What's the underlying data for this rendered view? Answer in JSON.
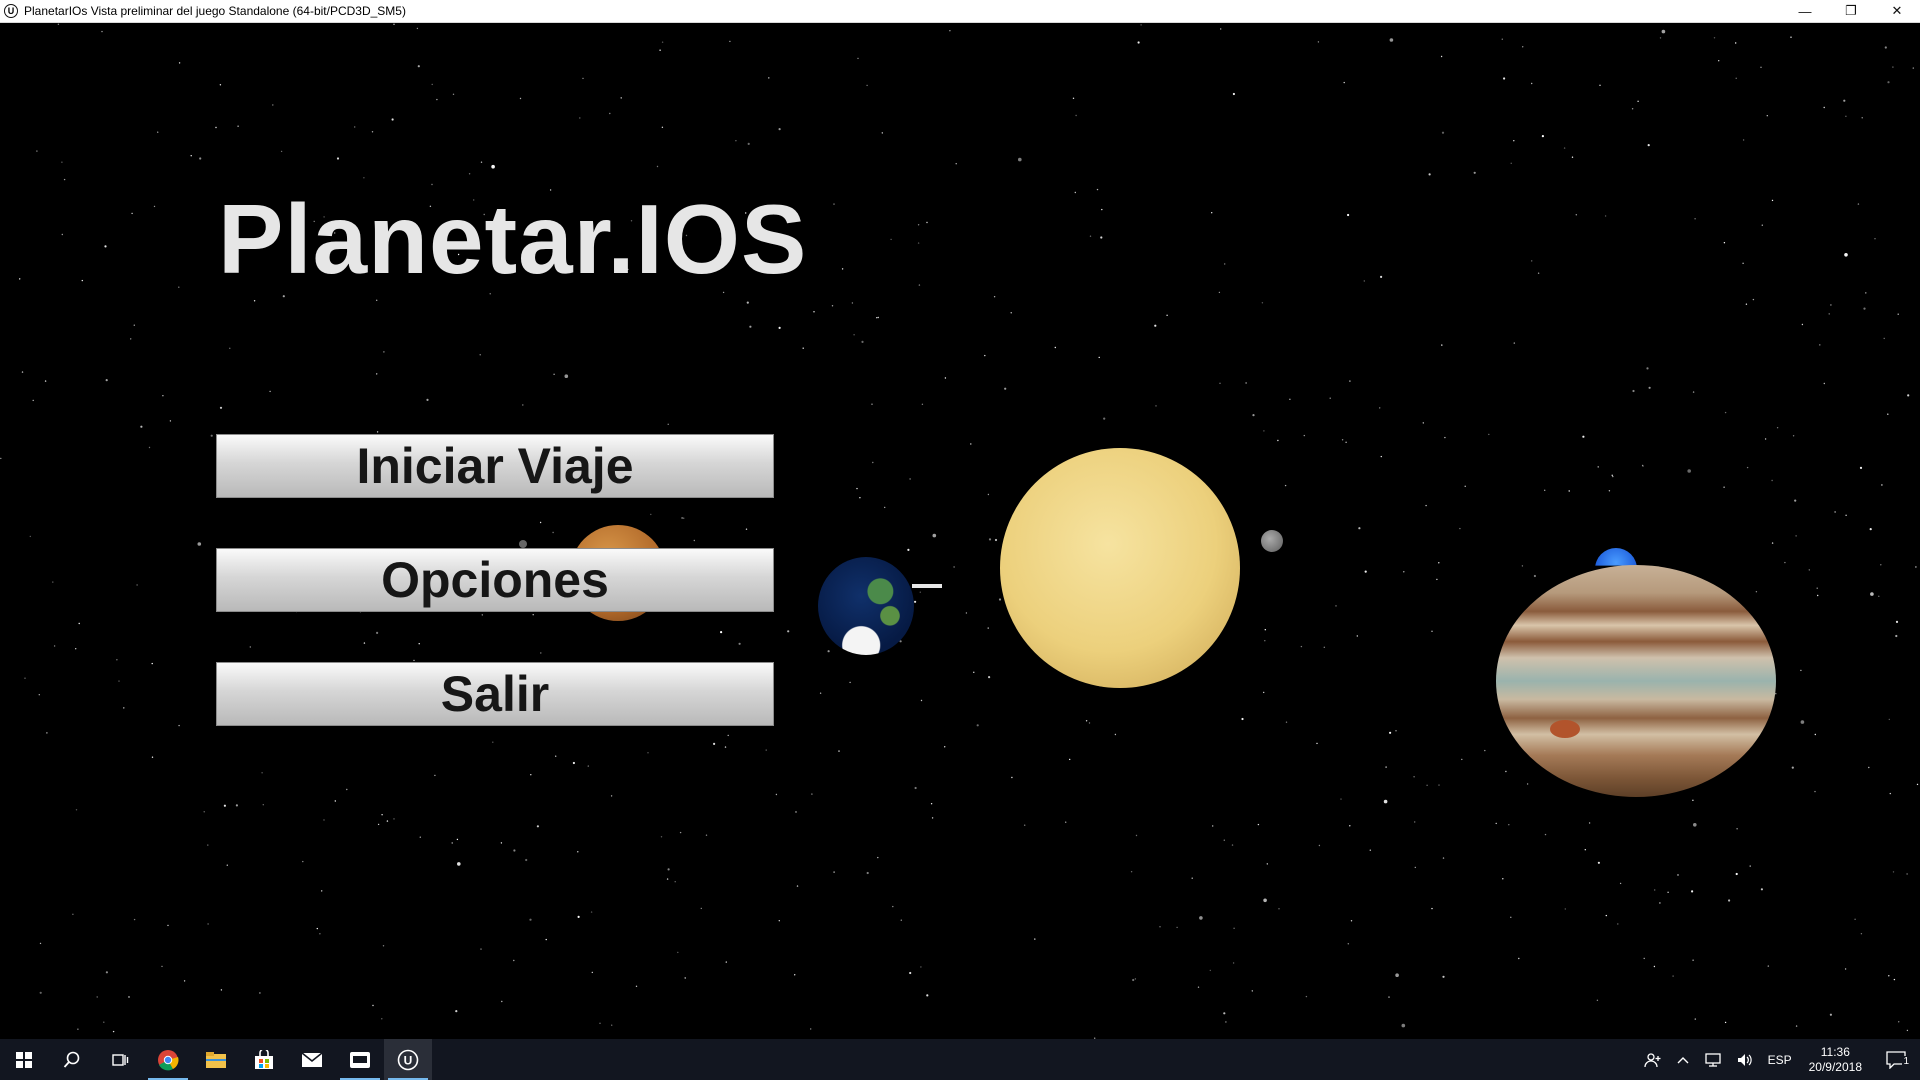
{
  "window": {
    "title": "PlanetarIOs Vista preliminar del juego Standalone (64-bit/PCD3D_SM5)",
    "app_icon": "unreal-engine-icon",
    "controls": {
      "minimize": "—",
      "restore": "❐",
      "close": "✕"
    }
  },
  "game": {
    "title": "Planetar.IOS",
    "menu": {
      "start": "Iniciar Viaje",
      "options": "Opciones",
      "exit": "Salir"
    },
    "scene_objects": [
      "mars",
      "earth",
      "spaceship",
      "sun",
      "moon",
      "jupiter",
      "neptune"
    ]
  },
  "taskbar": {
    "apps": [
      "start-icon",
      "search-icon",
      "task-view-icon",
      "chrome-icon",
      "file-explorer-icon",
      "store-icon",
      "mail-icon",
      "app-icon",
      "unreal-engine-icon"
    ],
    "tray": {
      "language": "ESP",
      "time": "11:36",
      "date": "20/9/2018",
      "notifications": "1"
    }
  }
}
